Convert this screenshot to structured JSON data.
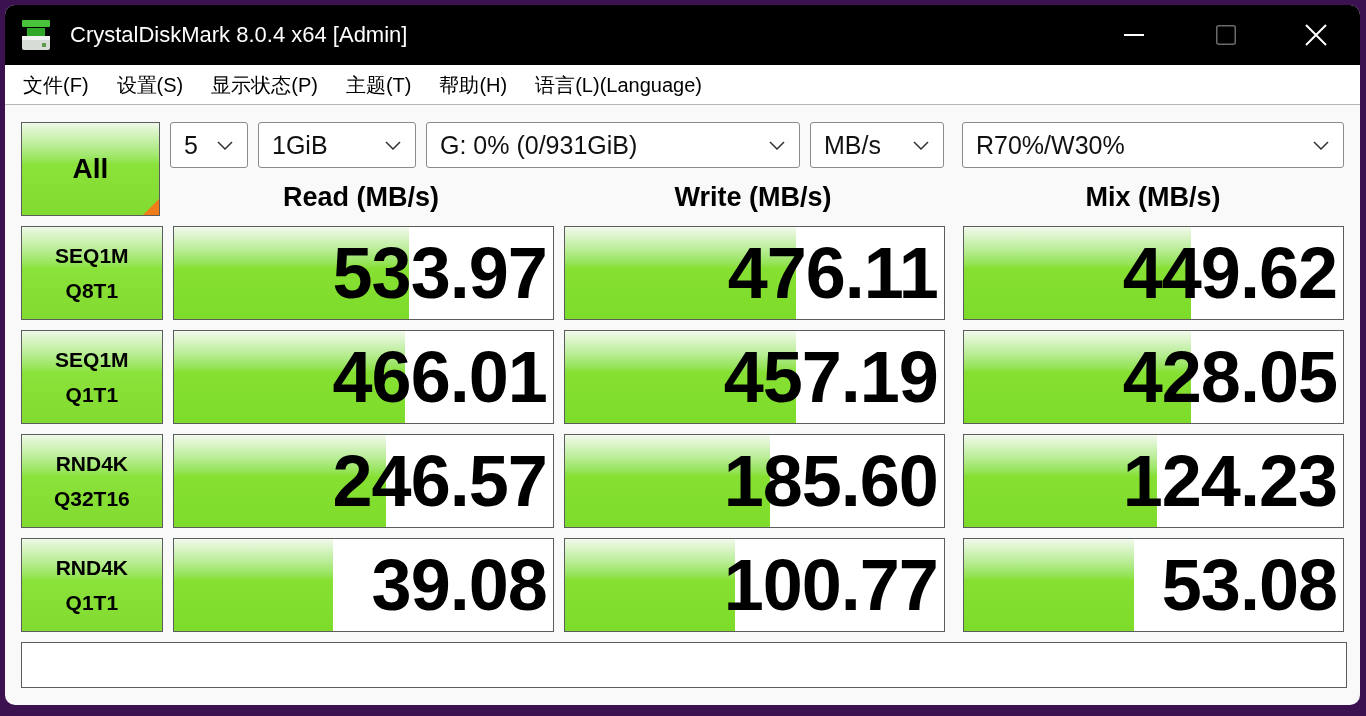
{
  "window": {
    "title": "CrystalDiskMark 8.0.4 x64 [Admin]"
  },
  "menu": [
    "文件(F)",
    "设置(S)",
    "显示状态(P)",
    "主题(T)",
    "帮助(H)",
    "语言(L)(Language)"
  ],
  "controls": {
    "all_button": "All",
    "dropdowns": [
      "5",
      "1GiB",
      "G: 0% (0/931GiB)",
      "MB/s",
      "R70%/W30%"
    ]
  },
  "columns": [
    "Read (MB/s)",
    "Write (MB/s)",
    "Mix (MB/s)"
  ],
  "rows": [
    {
      "test": [
        "SEQ1M",
        "Q8T1"
      ],
      "results": [
        {
          "reading": "533.97",
          "level": 0.62
        },
        {
          "reading": "476.11",
          "level": 0.61
        },
        {
          "reading": "449.62",
          "level": 0.6
        }
      ]
    },
    {
      "test": [
        "SEQ1M",
        "Q1T1"
      ],
      "results": [
        {
          "reading": "466.01",
          "level": 0.61
        },
        {
          "reading": "457.19",
          "level": 0.61
        },
        {
          "reading": "428.05",
          "level": 0.6
        }
      ]
    },
    {
      "test": [
        "RND4K",
        "Q32T16"
      ],
      "results": [
        {
          "reading": "246.57",
          "level": 0.56
        },
        {
          "reading": "185.60",
          "level": 0.54
        },
        {
          "reading": "124.23",
          "level": 0.51
        }
      ]
    },
    {
      "test": [
        "RND4K",
        "Q1T1"
      ],
      "results": [
        {
          "reading": "39.08",
          "level": 0.42
        },
        {
          "reading": "100.77",
          "level": 0.45
        },
        {
          "reading": "53.08",
          "level": 0.45
        }
      ]
    }
  ]
}
